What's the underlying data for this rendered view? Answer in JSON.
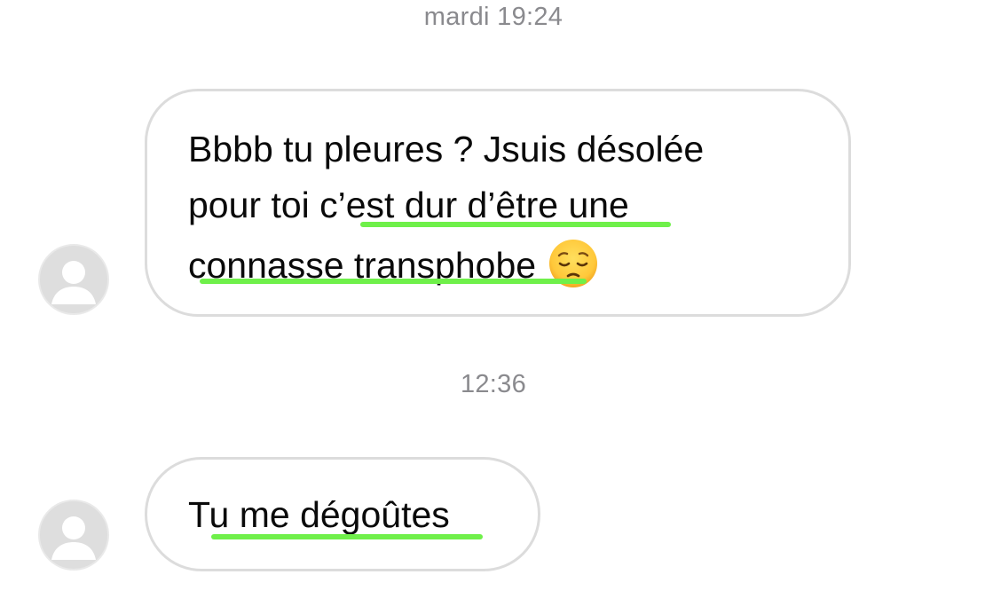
{
  "timestamps": {
    "first": "mardi 19:24",
    "second": "12:36"
  },
  "messages": [
    {
      "lines": [
        "Bbbb tu pleures ? Jsuis désolée",
        "pour toi c’est dur d’être une",
        "connasse transphobe"
      ],
      "emoji": "pensive-face-icon"
    },
    {
      "lines": [
        "Tu me dégoûtes"
      ]
    }
  ],
  "colors": {
    "highlight": "#6ff04a",
    "bubble_border": "#dcdcdc",
    "timestamp": "#8a8a8e",
    "avatar_bg": "#dedede"
  }
}
